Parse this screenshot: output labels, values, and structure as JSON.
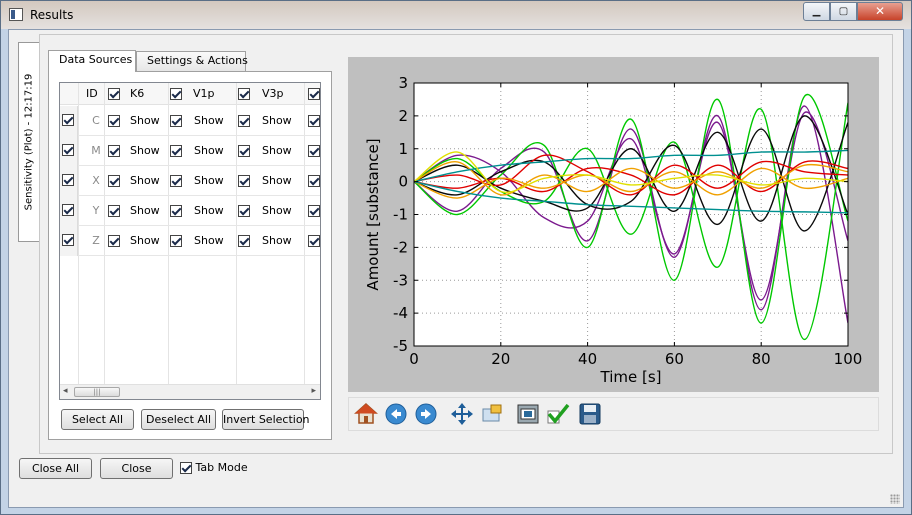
{
  "window": {
    "title": "Results",
    "min_glyph": "▁",
    "max_glyph": "▢",
    "close_glyph": "✕"
  },
  "vertical_tab": {
    "label": "Sensitivity (Plot) - 12:17:19"
  },
  "inner_tabs": [
    {
      "label": "Data Sources",
      "active": true
    },
    {
      "label": "Settings & Actions",
      "active": false
    }
  ],
  "table": {
    "id_header": "ID",
    "columns": [
      {
        "name": "K6",
        "checked": true
      },
      {
        "name": "V1p",
        "checked": true
      },
      {
        "name": "V3p",
        "checked": true
      }
    ],
    "cell_text": "Show",
    "rows": [
      "C",
      "M",
      "X",
      "Y",
      "Z"
    ],
    "scroll_left": "◂",
    "scroll_right": "▸",
    "scroll_grip": "|||"
  },
  "buttons": {
    "select_all": "Select All",
    "deselect_all": "Deselect All",
    "invert_selection": "Invert Selection",
    "close_all": "Close All",
    "close": "Close",
    "tab_mode": "Tab Mode"
  },
  "toolbar": {
    "icons": [
      "home-icon",
      "back-icon",
      "forward-icon",
      "pan-icon",
      "zoom-rect-icon",
      "subplots-config-icon",
      "check-icon",
      "save-icon"
    ]
  },
  "colors": {
    "series": [
      "#7b1a8e",
      "#00c800",
      "#0a0a0a",
      "#e00000",
      "#f0a000",
      "#009090",
      "#e0e000"
    ]
  },
  "chart_data": {
    "type": "line",
    "xlabel": "Time [s]",
    "ylabel": "Amount [substance]",
    "xlim": [
      0,
      100
    ],
    "ylim": [
      -5,
      3
    ],
    "xticks": [
      0,
      20,
      40,
      60,
      80,
      100
    ],
    "yticks": [
      -5,
      -4,
      -3,
      -2,
      -1,
      0,
      1,
      2,
      3
    ],
    "grid": true,
    "legend": false,
    "series": [
      {
        "color": "#7b1a8e",
        "x": [
          0,
          10,
          20,
          30,
          40,
          50,
          60,
          70,
          80,
          90,
          100
        ],
        "y": [
          0,
          0.8,
          0.3,
          -1.1,
          -1.2,
          1.3,
          -2.2,
          1.8,
          -3.6,
          2.1,
          -1.8
        ]
      },
      {
        "color": "#7b1a8e",
        "x": [
          0,
          10,
          20,
          30,
          40,
          50,
          60,
          70,
          80,
          90,
          100
        ],
        "y": [
          0,
          -0.9,
          0.4,
          0.9,
          -1.8,
          1.6,
          -2.3,
          2.0,
          -3.9,
          2.3,
          -4.3
        ]
      },
      {
        "color": "#00c800",
        "x": [
          0,
          10,
          20,
          30,
          40,
          50,
          60,
          70,
          80,
          90,
          100
        ],
        "y": [
          0,
          -1.0,
          0.2,
          1.1,
          -2.0,
          1.9,
          -3.0,
          2.5,
          -4.3,
          2.6,
          -1.2
        ]
      },
      {
        "color": "#00c800",
        "x": [
          0,
          10,
          20,
          30,
          40,
          50,
          60,
          70,
          80,
          90,
          100
        ],
        "y": [
          0,
          0.7,
          -0.3,
          -0.6,
          1.0,
          -1.6,
          1.2,
          -2.6,
          2.2,
          -4.8,
          2.4
        ]
      },
      {
        "color": "#0a0a0a",
        "x": [
          0,
          10,
          20,
          30,
          40,
          50,
          60,
          70,
          80,
          90,
          100
        ],
        "y": [
          0,
          0.5,
          -0.2,
          -0.6,
          -0.8,
          1.0,
          -0.9,
          1.5,
          -1.2,
          2.0,
          -1.0
        ]
      },
      {
        "color": "#0a0a0a",
        "x": [
          0,
          10,
          20,
          30,
          40,
          50,
          60,
          70,
          80,
          90,
          100
        ],
        "y": [
          0,
          -0.4,
          0.3,
          0.6,
          -0.7,
          -0.6,
          1.1,
          -1.3,
          1.6,
          -1.5,
          1.8
        ]
      },
      {
        "color": "#e00000",
        "x": [
          0,
          10,
          20,
          30,
          40,
          50,
          60,
          70,
          80,
          90,
          100
        ],
        "y": [
          0,
          0.2,
          -0.1,
          0.8,
          0.3,
          -0.4,
          0.5,
          -0.2,
          0.6,
          0.3,
          0.2
        ]
      },
      {
        "color": "#e00000",
        "x": [
          0,
          10,
          20,
          30,
          40,
          50,
          60,
          70,
          80,
          90,
          100
        ],
        "y": [
          0,
          -0.2,
          0.1,
          -0.3,
          0.4,
          0.2,
          -0.4,
          0.5,
          -0.3,
          0.6,
          0.4
        ]
      },
      {
        "color": "#f0a000",
        "x": [
          0,
          10,
          20,
          30,
          40,
          50,
          60,
          70,
          80,
          90,
          100
        ],
        "y": [
          0,
          0.6,
          -0.4,
          0.2,
          -0.3,
          0.4,
          -0.2,
          0.3,
          -0.2,
          0.5,
          0.3
        ]
      },
      {
        "color": "#f0a000",
        "x": [
          0,
          10,
          20,
          30,
          40,
          50,
          60,
          70,
          80,
          90,
          100
        ],
        "y": [
          0,
          -0.5,
          0.1,
          -0.2,
          0.2,
          -0.3,
          0.3,
          -0.4,
          0.4,
          -0.2,
          0.1
        ]
      },
      {
        "color": "#009090",
        "x": [
          0,
          10,
          20,
          30,
          40,
          50,
          60,
          70,
          80,
          90,
          100
        ],
        "y": [
          0,
          0.3,
          0.5,
          0.6,
          0.7,
          0.7,
          0.8,
          0.8,
          0.9,
          0.9,
          0.95
        ]
      },
      {
        "color": "#009090",
        "x": [
          0,
          10,
          20,
          30,
          40,
          50,
          60,
          70,
          80,
          90,
          100
        ],
        "y": [
          0,
          -0.3,
          -0.5,
          -0.6,
          -0.7,
          -0.75,
          -0.8,
          -0.85,
          -0.9,
          -0.92,
          -0.95
        ]
      },
      {
        "color": "#e0e000",
        "x": [
          0,
          10,
          20,
          30,
          40,
          50,
          60,
          70,
          80,
          90,
          100
        ],
        "y": [
          0,
          0.9,
          -0.3,
          0.1,
          0.2,
          -0.1,
          0.1,
          0.2,
          -0.1,
          0.1,
          0.0
        ]
      }
    ]
  }
}
